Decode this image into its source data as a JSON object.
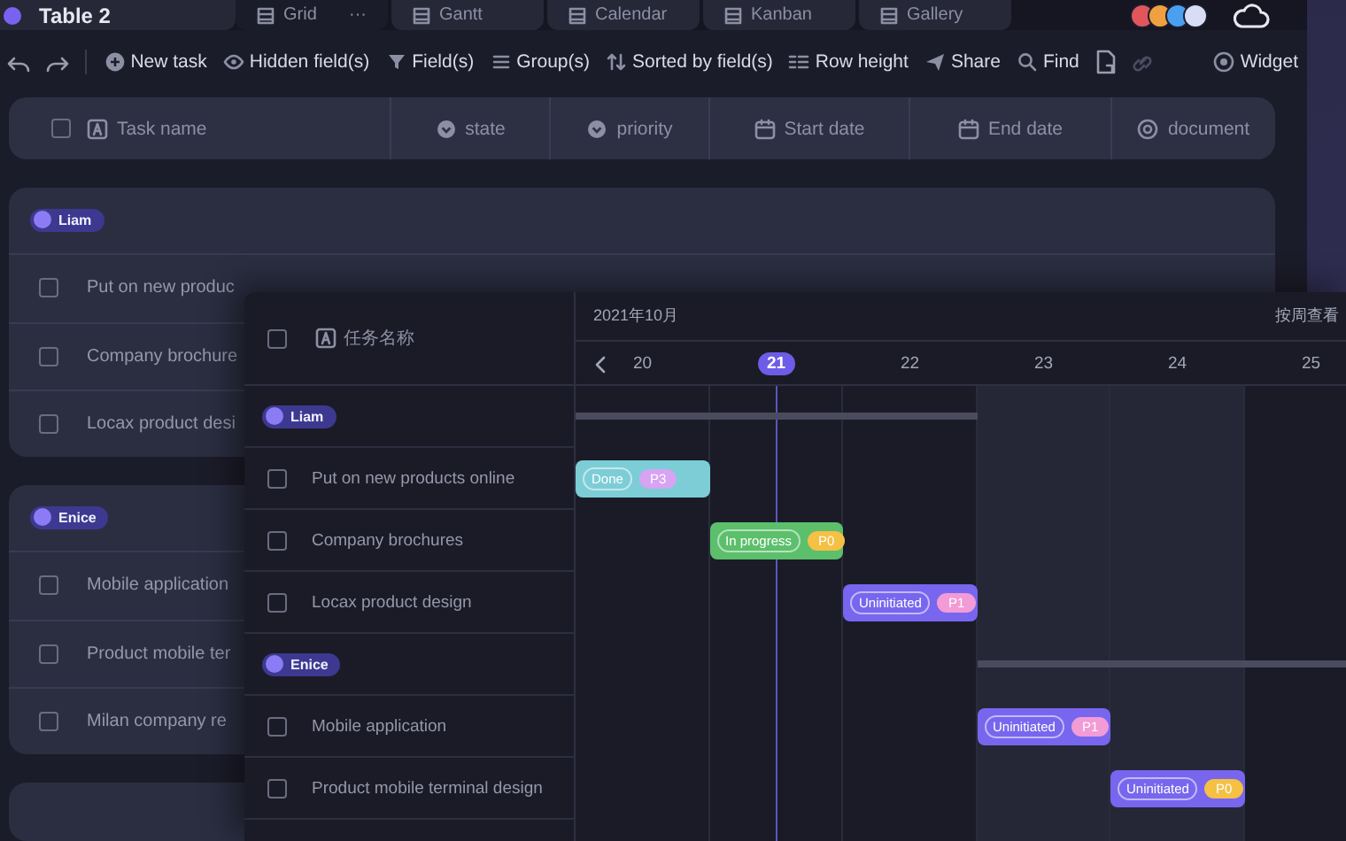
{
  "tabs": {
    "title": "Table 2",
    "views": [
      {
        "label": "Grid",
        "selected": true,
        "more": "···"
      },
      {
        "label": "Gantt",
        "selected": false
      },
      {
        "label": "Calendar",
        "selected": false
      },
      {
        "label": "Kanban",
        "selected": false
      },
      {
        "label": "Gallery",
        "selected": false
      }
    ]
  },
  "toolbar": [
    {
      "kind": "icon"
    },
    {
      "kind": "icon"
    },
    {
      "kind": "button",
      "label": "New task"
    },
    {
      "kind": "button",
      "label": "Hidden field(s)"
    },
    {
      "kind": "button",
      "label": "Field(s)"
    },
    {
      "kind": "button",
      "label": "Group(s)"
    },
    {
      "kind": "button",
      "label": "Sorted by field(s)"
    },
    {
      "kind": "button",
      "label": "Row height"
    },
    {
      "kind": "button",
      "label": "Share"
    },
    {
      "kind": "button",
      "label": "Find"
    },
    {
      "kind": "icon"
    },
    {
      "kind": "icon",
      "disabled": true
    },
    {
      "kind": "button",
      "label": "Widget"
    }
  ],
  "columns": [
    {
      "label": "Task name",
      "kind": "text"
    },
    {
      "label": "state",
      "kind": "select"
    },
    {
      "label": "priority",
      "kind": "select"
    },
    {
      "label": "Start date",
      "kind": "date"
    },
    {
      "label": "End date",
      "kind": "date"
    },
    {
      "label": "document",
      "kind": "attachment"
    }
  ],
  "header_checked": false,
  "groups": [
    {
      "label": "Liam",
      "color": "#8b7cf6",
      "rows": [
        {
          "name": "Put on new produc",
          "checked": false
        },
        {
          "name": "Company brochure",
          "checked": false
        },
        {
          "name": "Locax product desi",
          "checked": false
        }
      ]
    },
    {
      "label": "Enice",
      "color": "#8b7cf6",
      "rows": [
        {
          "name": "Mobile application",
          "checked": false
        },
        {
          "name": "Product mobile ter",
          "checked": false
        },
        {
          "name": "Milan  company re",
          "checked": false
        }
      ]
    }
  ],
  "gantt": {
    "header_label": "任务名称",
    "header_checked": false,
    "month": "2021年10月",
    "view_toggle": "按周查看",
    "days": [
      {
        "label": "20",
        "selected": false,
        "weekend": false
      },
      {
        "label": "21",
        "selected": true,
        "weekend": false
      },
      {
        "label": "22",
        "selected": false,
        "weekend": false
      },
      {
        "label": "23",
        "selected": false,
        "weekend": true
      },
      {
        "label": "24",
        "selected": false,
        "weekend": true
      },
      {
        "label": "25",
        "selected": false,
        "weekend": false
      }
    ],
    "rows": [
      {
        "kind": "group",
        "label": "Liam",
        "color": "#8b7cf6",
        "span": [
          true,
          true,
          true,
          false,
          false,
          false
        ]
      },
      {
        "kind": "task",
        "name": "Put on new products online",
        "checked": false,
        "span": [
          true,
          false,
          false,
          false,
          false,
          false
        ],
        "bar": {
          "status": "Done",
          "color": "#7ccdd6",
          "priority": {
            "label": "P3",
            "color": "#d7a3f3"
          }
        }
      },
      {
        "kind": "task",
        "name": "Company brochures",
        "checked": false,
        "span": [
          false,
          true,
          false,
          false,
          false,
          false
        ],
        "bar": {
          "status": "In progress",
          "color": "#5cbf6c",
          "priority": {
            "label": "P0",
            "color": "#f5c044"
          }
        }
      },
      {
        "kind": "task",
        "name": "Locax product design",
        "checked": false,
        "span": [
          false,
          false,
          true,
          false,
          false,
          false
        ],
        "bar": {
          "status": "Uninitiated",
          "color": "#7866ee",
          "priority": {
            "label": "P1",
            "color": "#f39bd6"
          }
        }
      },
      {
        "kind": "group",
        "label": "Enice",
        "color": "#8b7cf6",
        "span": [
          false,
          false,
          false,
          true,
          true,
          true
        ]
      },
      {
        "kind": "task",
        "name": "Mobile application",
        "checked": false,
        "span": [
          false,
          false,
          false,
          true,
          false,
          false
        ],
        "bar": {
          "status": "Uninitiated",
          "color": "#7866ee",
          "priority": {
            "label": "P1",
            "color": "#f39bd6"
          }
        }
      },
      {
        "kind": "task",
        "name": "Product mobile terminal design",
        "checked": false,
        "span": [
          false,
          false,
          false,
          false,
          true,
          false
        ],
        "bar": {
          "status": "Uninitiated",
          "color": "#7866ee",
          "priority": {
            "label": "P0",
            "color": "#f5c044"
          }
        }
      }
    ]
  }
}
